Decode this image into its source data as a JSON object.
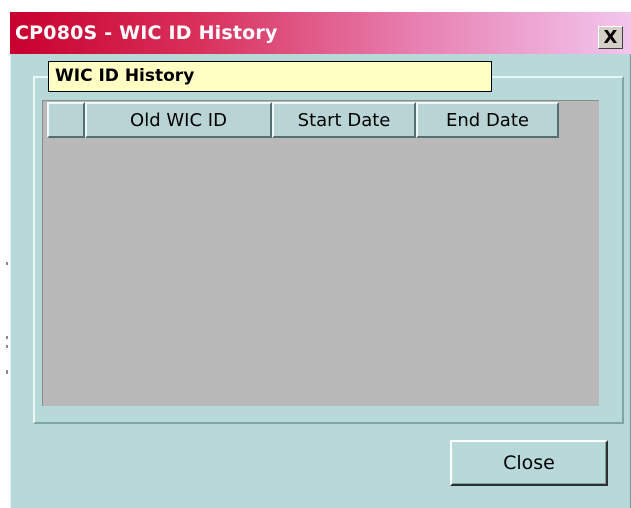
{
  "window": {
    "title": "CP080S - WIC ID History",
    "close_glyph": "X",
    "accent_colors": {
      "titlebar_start": "#c8002e",
      "titlebar_end": "#f2c6ee",
      "window_bg": "#b7d9d9",
      "grid_bg": "#b9b9b9",
      "label_bg": "#ffffc3"
    }
  },
  "group": {
    "label": "WIC ID History"
  },
  "grid": {
    "columns": [
      "",
      "Old WIC ID",
      "Start Date",
      "End Date"
    ],
    "rows": []
  },
  "footer": {
    "close_label": "Close"
  }
}
